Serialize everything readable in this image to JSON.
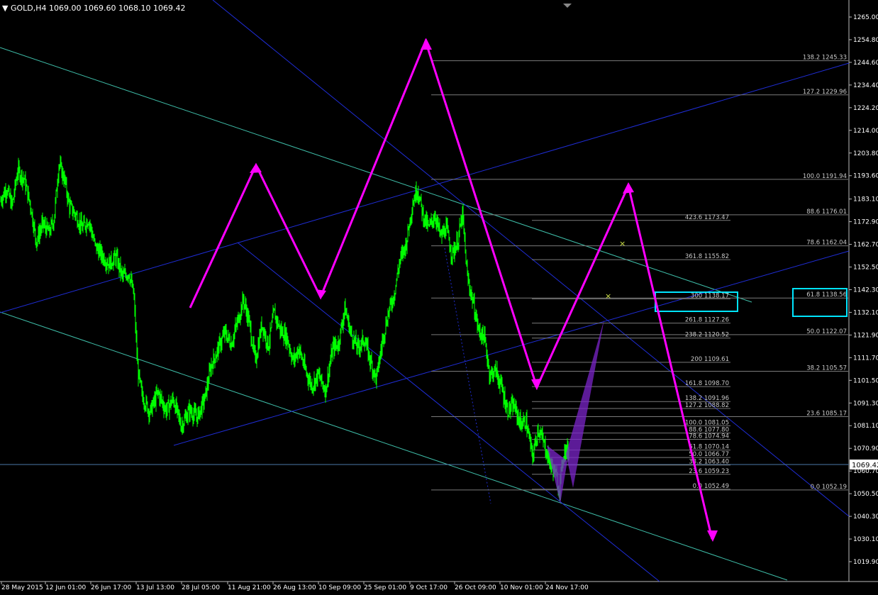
{
  "header": {
    "symbol_line": "▼ GOLD,H4 1069.00 1069.60 1068.10 1069.42"
  },
  "colors": {
    "background": "#000000",
    "candles": "#00ff00",
    "blue_channel": "#1f2dd6",
    "aqua_channel": "#3fbfaa",
    "projection": "#ff00ff",
    "fibo_level": "#7a7a7a",
    "fibo_text": "#c8c8c8",
    "target_box": "#00e5ff",
    "harmonic_fill": "#7b24c9",
    "current_price": "#ffffff"
  },
  "chart_data": {
    "type": "candlestick",
    "timeframe": "H4",
    "symbol": "GOLD",
    "current_price": 1069.42,
    "ylim": [
      1015,
      1272
    ],
    "y_ticks": [
      "1265.00",
      "1254.80",
      "1244.60",
      "1234.40",
      "1224.20",
      "1214.00",
      "1203.80",
      "1193.60",
      "1183.10",
      "1172.90",
      "1162.70",
      "1152.50",
      "1142.30",
      "1132.10",
      "1121.90",
      "1111.70",
      "1101.50",
      "1091.30",
      "1081.10",
      "1070.90",
      "1060.70",
      "1050.50",
      "1040.30",
      "1030.10",
      "1019.90"
    ],
    "x_ticks": [
      "28 May 2015",
      "12 Jun 01:00",
      "26 Jun 17:00",
      "13 Jul 13:00",
      "28 Jul 05:00",
      "11 Aug 21:00",
      "26 Aug 13:00",
      "10 Sep 09:00",
      "25 Sep 01:00",
      "9 Oct 17:00",
      "26 Oct 09:00",
      "10 Nov 01:00",
      "24 Nov 17:00"
    ],
    "price_path": [
      [
        0,
        1182
      ],
      [
        0.8,
        1188
      ],
      [
        1.5,
        1180
      ],
      [
        2.2,
        1196
      ],
      [
        3.0,
        1192
      ],
      [
        3.8,
        1180
      ],
      [
        4.5,
        1164
      ],
      [
        5.3,
        1172
      ],
      [
        6.1,
        1168
      ],
      [
        6.7,
        1174
      ],
      [
        7.3,
        1199
      ],
      [
        8.0,
        1192
      ],
      [
        8.6,
        1180
      ],
      [
        9.4,
        1176
      ],
      [
        10.2,
        1170
      ],
      [
        11.0,
        1174
      ],
      [
        11.8,
        1162
      ],
      [
        12.6,
        1158
      ],
      [
        13.5,
        1154
      ],
      [
        14.4,
        1157
      ],
      [
        15.2,
        1148
      ],
      [
        16.0,
        1150
      ],
      [
        16.6,
        1140
      ],
      [
        17.1,
        1106
      ],
      [
        17.6,
        1095
      ],
      [
        18.6,
        1087
      ],
      [
        19.6,
        1096
      ],
      [
        20.6,
        1088
      ],
      [
        21.5,
        1093
      ],
      [
        22.5,
        1081
      ],
      [
        23.5,
        1088
      ],
      [
        24.5,
        1085
      ],
      [
        25.4,
        1093
      ],
      [
        26.2,
        1108
      ],
      [
        27.0,
        1115
      ],
      [
        27.9,
        1123
      ],
      [
        28.7,
        1118
      ],
      [
        29.5,
        1128
      ],
      [
        30.2,
        1138
      ],
      [
        30.9,
        1128
      ],
      [
        31.7,
        1110
      ],
      [
        32.5,
        1127
      ],
      [
        33.3,
        1117
      ],
      [
        34.0,
        1132
      ],
      [
        34.8,
        1124
      ],
      [
        35.6,
        1121
      ],
      [
        36.4,
        1110
      ],
      [
        37.1,
        1116
      ],
      [
        37.9,
        1106
      ],
      [
        38.7,
        1099
      ],
      [
        39.5,
        1104
      ],
      [
        40.4,
        1097
      ],
      [
        41.3,
        1116
      ],
      [
        42.0,
        1118
      ],
      [
        42.8,
        1134
      ],
      [
        43.6,
        1122
      ],
      [
        44.4,
        1116
      ],
      [
        45.2,
        1120
      ],
      [
        46.0,
        1110
      ],
      [
        46.7,
        1102
      ],
      [
        47.5,
        1120
      ],
      [
        48.2,
        1132
      ],
      [
        48.9,
        1140
      ],
      [
        49.6,
        1155
      ],
      [
        50.4,
        1163
      ],
      [
        51.2,
        1181
      ],
      [
        51.8,
        1188
      ],
      [
        52.5,
        1176
      ],
      [
        53.2,
        1170
      ],
      [
        54.0,
        1176
      ],
      [
        54.7,
        1166
      ],
      [
        55.4,
        1170
      ],
      [
        56.1,
        1158
      ],
      [
        56.8,
        1164
      ],
      [
        57.4,
        1176
      ],
      [
        58.0,
        1148
      ],
      [
        58.7,
        1137
      ],
      [
        59.4,
        1124
      ],
      [
        60.1,
        1121
      ],
      [
        60.8,
        1104
      ],
      [
        61.5,
        1106
      ],
      [
        62.2,
        1099
      ],
      [
        63.0,
        1088
      ],
      [
        63.8,
        1090
      ],
      [
        64.6,
        1082
      ],
      [
        65.3,
        1083
      ],
      [
        66.1,
        1067
      ],
      [
        66.8,
        1080
      ],
      [
        67.6,
        1072
      ],
      [
        68.3,
        1064
      ],
      [
        68.9,
        1060
      ],
      [
        69.4,
        1052
      ],
      [
        70.0,
        1070
      ],
      [
        70.6,
        1069.42
      ]
    ]
  },
  "x_axis": {
    "labels": [
      "28 May 2015",
      "12 Jun 01:00",
      "26 Jun 17:00",
      "13 Jul 13:00",
      "28 Jul 05:00",
      "11 Aug 21:00",
      "26 Aug 13:00",
      "10 Sep 09:00",
      "25 Sep 01:00",
      "9 Oct 17:00",
      "26 Oct 09:00",
      "10 Nov 01:00",
      "24 Nov 17:00"
    ]
  },
  "fib_sets": {
    "retracement_large": [
      {
        "level": "138.2",
        "price": "1245.33"
      },
      {
        "level": "127.2",
        "price": "1229.96"
      },
      {
        "level": "100.0",
        "price": "1191.94"
      },
      {
        "level": "88.6",
        "price": "1176.01"
      },
      {
        "level": "78.6",
        "price": "1162.04"
      },
      {
        "level": "61.8",
        "price": "1138.56"
      },
      {
        "level": "50.0",
        "price": "1122.07"
      },
      {
        "level": "38.2",
        "price": "1105.57"
      },
      {
        "level": "23.6",
        "price": "1085.17"
      },
      {
        "level": "0.0",
        "price": "1052.19"
      }
    ],
    "extension": [
      {
        "level": "423.6",
        "price": "1173.47"
      },
      {
        "level": "361.8",
        "price": "1155.82"
      },
      {
        "level": "300",
        "price": "1138.17"
      },
      {
        "level": "261.8",
        "price": "1127.26"
      },
      {
        "level": "238.2",
        "price": "1120.52"
      },
      {
        "level": "200",
        "price": "1109.61"
      },
      {
        "level": "161.8",
        "price": "1098.70"
      },
      {
        "level": "138.2",
        "price": "1091.96"
      },
      {
        "level": "127.2",
        "price": "1088.82"
      },
      {
        "level": "100.0",
        "price": "1081.05"
      },
      {
        "level": "88.6",
        "price": "1077.80"
      },
      {
        "level": "78.6",
        "price": "1074.94"
      },
      {
        "level": "61.8",
        "price": "1070.14"
      },
      {
        "level": "50.0",
        "price": "1066.77"
      },
      {
        "level": "38.2",
        "price": "1063.40"
      },
      {
        "level": "23.6",
        "price": "1059.23"
      },
      {
        "level": "0.0",
        "price": "1052.49"
      }
    ]
  },
  "projection_path": [
    [
      "2015-07-20",
      1128
    ],
    [
      "2015-08-05",
      1200
    ],
    [
      "2015-09-03",
      1136
    ],
    [
      "2015-10-05",
      1253
    ],
    [
      "2015-11-10",
      1100
    ],
    [
      "2015-12-15",
      1191
    ],
    [
      "2016-01-04",
      1038
    ]
  ]
}
